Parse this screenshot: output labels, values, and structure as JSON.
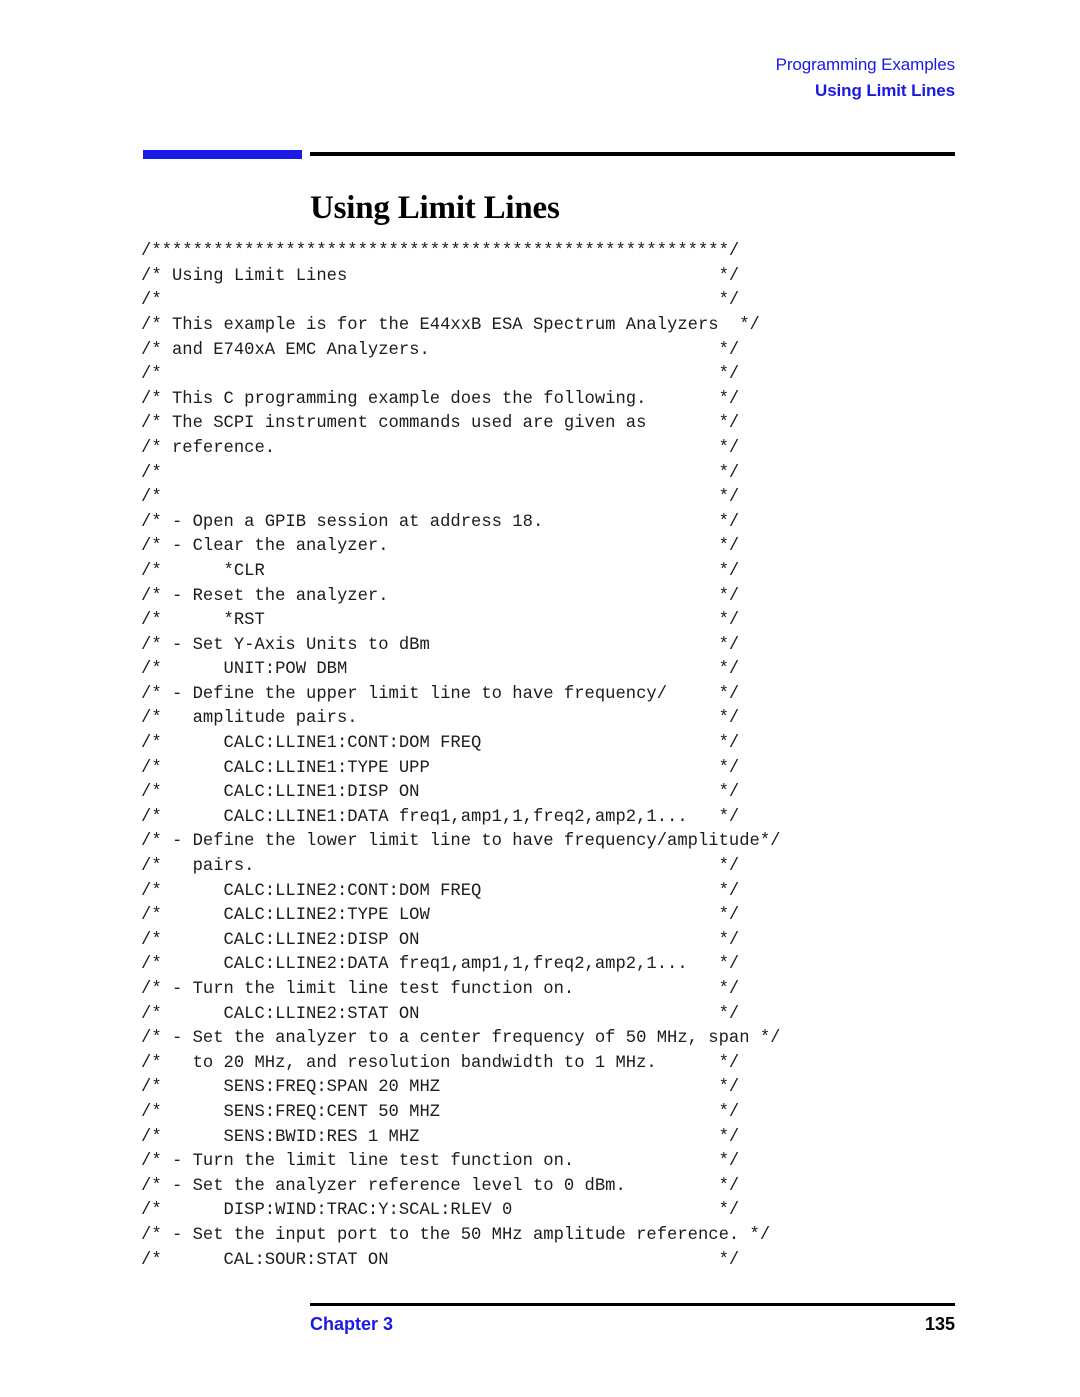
{
  "header": {
    "line1": "Programming Examples",
    "line2": "Using Limit Lines"
  },
  "title": "Using Limit Lines",
  "code": {
    "language": "c-comment-block",
    "lines": [
      "/********************************************************/",
      "/* Using Limit Lines                                    */",
      "/*                                                      */",
      "/* This example is for the E44xxB ESA Spectrum Analyzers  */",
      "/* and E740xA EMC Analyzers.                            */",
      "/*                                                      */",
      "/* This C programming example does the following.       */",
      "/* The SCPI instrument commands used are given as       */",
      "/* reference.                                           */",
      "/*                                                      */",
      "/*                                                      */",
      "/* - Open a GPIB session at address 18.                 */",
      "/* - Clear the analyzer.                                */",
      "/*      *CLR                                            */",
      "/* - Reset the analyzer.                                */",
      "/*      *RST                                            */",
      "/* - Set Y-Axis Units to dBm                            */",
      "/*      UNIT:POW DBM                                    */",
      "/* - Define the upper limit line to have frequency/     */",
      "/*   amplitude pairs.                                   */",
      "/*      CALC:LLINE1:CONT:DOM FREQ                       */",
      "/*      CALC:LLINE1:TYPE UPP                            */",
      "/*      CALC:LLINE1:DISP ON                             */",
      "/*      CALC:LLINE1:DATA freq1,amp1,1,freq2,amp2,1...   */",
      "/* - Define the lower limit line to have frequency/amplitude*/",
      "/*   pairs.                                             */",
      "/*      CALC:LLINE2:CONT:DOM FREQ                       */",
      "/*      CALC:LLINE2:TYPE LOW                            */",
      "/*      CALC:LLINE2:DISP ON                             */",
      "/*      CALC:LLINE2:DATA freq1,amp1,1,freq2,amp2,1...   */",
      "/* - Turn the limit line test function on.              */",
      "/*      CALC:LLINE2:STAT ON                             */",
      "/* - Set the analyzer to a center frequency of 50 MHz, span */",
      "/*   to 20 MHz, and resolution bandwidth to 1 MHz.      */",
      "/*      SENS:FREQ:SPAN 20 MHZ                           */",
      "/*      SENS:FREQ:CENT 50 MHZ                           */",
      "/*      SENS:BWID:RES 1 MHZ                             */",
      "/* - Turn the limit line test function on.              */",
      "/* - Set the analyzer reference level to 0 dBm.         */",
      "/*      DISP:WIND:TRAC:Y:SCAL:RLEV 0                    */",
      "/* - Set the input port to the 50 MHz amplitude reference. */",
      "/*      CAL:SOUR:STAT ON                                */"
    ]
  },
  "footer": {
    "chapter": "Chapter 3",
    "page_number": "135"
  },
  "colors": {
    "accent_blue": "#1a1ae6",
    "rule_black": "#000000",
    "code_text": "#1c1c1c"
  }
}
